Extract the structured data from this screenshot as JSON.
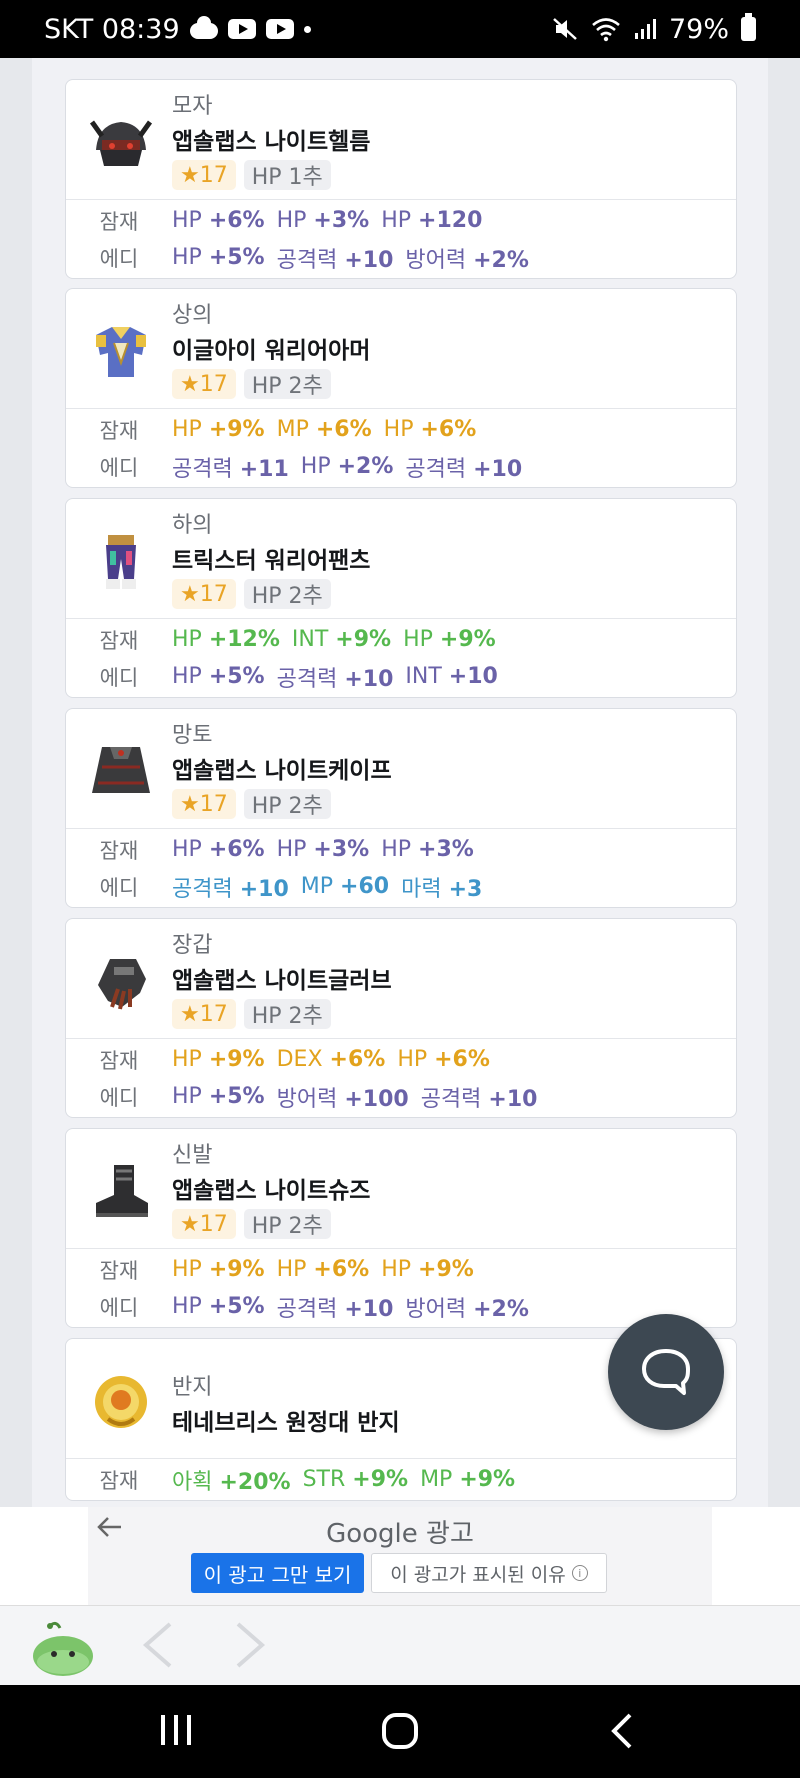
{
  "status_bar": {
    "carrier_time": "SKT 08:39",
    "battery": "79%"
  },
  "items": [
    {
      "category": "모자",
      "name": "앱솔랩스 나이트헬름",
      "star": "★17",
      "hp_tag": "HP 1추",
      "potential_label": "잠재",
      "potential": [
        {
          "k": "HP",
          "v": "+6%",
          "c": "purple"
        },
        {
          "k": "HP",
          "v": "+3%",
          "c": "purple"
        },
        {
          "k": "HP",
          "v": "+120",
          "c": "purple"
        }
      ],
      "additional_label": "에디",
      "additional": [
        {
          "k": "HP",
          "v": "+5%",
          "c": "purple"
        },
        {
          "k": "공격력",
          "v": "+10",
          "c": "purple"
        },
        {
          "k": "방어력",
          "v": "+2%",
          "c": "purple"
        }
      ]
    },
    {
      "category": "상의",
      "name": "이글아이 워리어아머",
      "star": "★17",
      "hp_tag": "HP 2추",
      "potential_label": "잠재",
      "potential": [
        {
          "k": "HP",
          "v": "+9%",
          "c": "yellow"
        },
        {
          "k": "MP",
          "v": "+6%",
          "c": "yellow"
        },
        {
          "k": "HP",
          "v": "+6%",
          "c": "yellow"
        }
      ],
      "additional_label": "에디",
      "additional": [
        {
          "k": "공격력",
          "v": "+11",
          "c": "purple"
        },
        {
          "k": "HP",
          "v": "+2%",
          "c": "purple"
        },
        {
          "k": "공격력",
          "v": "+10",
          "c": "purple"
        }
      ]
    },
    {
      "category": "하의",
      "name": "트릭스터 워리어팬츠",
      "star": "★17",
      "hp_tag": "HP 2추",
      "potential_label": "잠재",
      "potential": [
        {
          "k": "HP",
          "v": "+12%",
          "c": "green"
        },
        {
          "k": "INT",
          "v": "+9%",
          "c": "green"
        },
        {
          "k": "HP",
          "v": "+9%",
          "c": "green"
        }
      ],
      "additional_label": "에디",
      "additional": [
        {
          "k": "HP",
          "v": "+5%",
          "c": "purple"
        },
        {
          "k": "공격력",
          "v": "+10",
          "c": "purple"
        },
        {
          "k": "INT",
          "v": "+10",
          "c": "purple"
        }
      ]
    },
    {
      "category": "망토",
      "name": "앱솔랩스 나이트케이프",
      "star": "★17",
      "hp_tag": "HP 2추",
      "potential_label": "잠재",
      "potential": [
        {
          "k": "HP",
          "v": "+6%",
          "c": "purple"
        },
        {
          "k": "HP",
          "v": "+3%",
          "c": "purple"
        },
        {
          "k": "HP",
          "v": "+3%",
          "c": "purple"
        }
      ],
      "additional_label": "에디",
      "additional": [
        {
          "k": "공격력",
          "v": "+10",
          "c": "blue"
        },
        {
          "k": "MP",
          "v": "+60",
          "c": "blue"
        },
        {
          "k": "마력",
          "v": "+3",
          "c": "blue"
        }
      ]
    },
    {
      "category": "장갑",
      "name": "앱솔랩스 나이트글러브",
      "star": "★17",
      "hp_tag": "HP 2추",
      "potential_label": "잠재",
      "potential": [
        {
          "k": "HP",
          "v": "+9%",
          "c": "yellow"
        },
        {
          "k": "DEX",
          "v": "+6%",
          "c": "yellow"
        },
        {
          "k": "HP",
          "v": "+6%",
          "c": "yellow"
        }
      ],
      "additional_label": "에디",
      "additional": [
        {
          "k": "HP",
          "v": "+5%",
          "c": "purple"
        },
        {
          "k": "방어력",
          "v": "+100",
          "c": "purple"
        },
        {
          "k": "공격력",
          "v": "+10",
          "c": "purple"
        }
      ]
    },
    {
      "category": "신발",
      "name": "앱솔랩스 나이트슈즈",
      "star": "★17",
      "hp_tag": "HP 2추",
      "potential_label": "잠재",
      "potential": [
        {
          "k": "HP",
          "v": "+9%",
          "c": "yellow"
        },
        {
          "k": "HP",
          "v": "+6%",
          "c": "yellow"
        },
        {
          "k": "HP",
          "v": "+9%",
          "c": "yellow"
        }
      ],
      "additional_label": "에디",
      "additional": [
        {
          "k": "HP",
          "v": "+5%",
          "c": "purple"
        },
        {
          "k": "공격력",
          "v": "+10",
          "c": "purple"
        },
        {
          "k": "방어력",
          "v": "+2%",
          "c": "purple"
        }
      ]
    },
    {
      "category": "반지",
      "name": "테네브리스 원정대 반지",
      "potential_label": "잠재",
      "potential": [
        {
          "k": "아획",
          "v": "+20%",
          "c": "green"
        },
        {
          "k": "STR",
          "v": "+9%",
          "c": "green"
        },
        {
          "k": "MP",
          "v": "+9%",
          "c": "green"
        }
      ]
    }
  ],
  "ad": {
    "brand": "Google 광고",
    "stop_label": "이 광고 그만 보기",
    "why_label": "이 광고가 표시된 이유"
  }
}
